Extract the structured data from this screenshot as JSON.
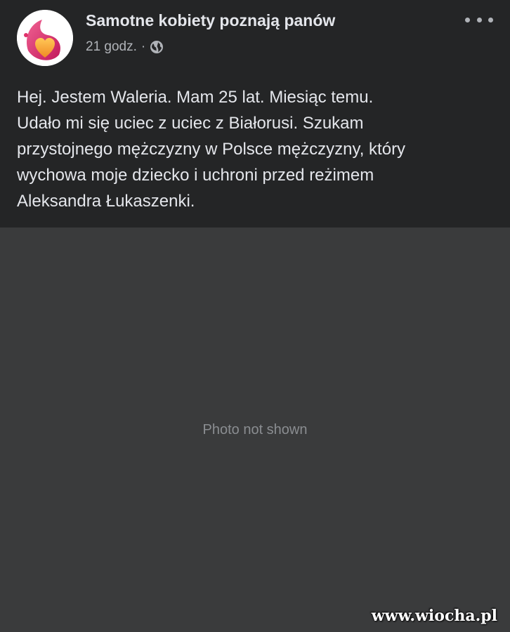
{
  "post": {
    "page_name": "Samotne kobiety poznają panów",
    "timestamp": "21 godz.",
    "separator": "·",
    "privacy_icon": "globe-icon",
    "more_icon": "more-options-icon",
    "avatar_icon": "heart-logo-icon",
    "text_lines": [
      "Hej. Jestem Waleria. Mam 25 lat. Miesiąc temu.",
      "Udało mi się uciec z uciec z Białorusi. Szukam",
      "przystojnego mężczyzny w Polsce mężczyzny, który",
      "wychowa moje dziecko i uchroni przed reżimem",
      "Aleksandra Łukaszenki."
    ]
  },
  "photo": {
    "placeholder": "Photo not shown"
  },
  "watermark": "www.wiocha.pl",
  "colors": {
    "background": "#242526",
    "text_primary": "#e4e6eb",
    "text_secondary": "#b0b3b8",
    "logo_pink": "#e0306a",
    "logo_orange": "#f7a234"
  }
}
